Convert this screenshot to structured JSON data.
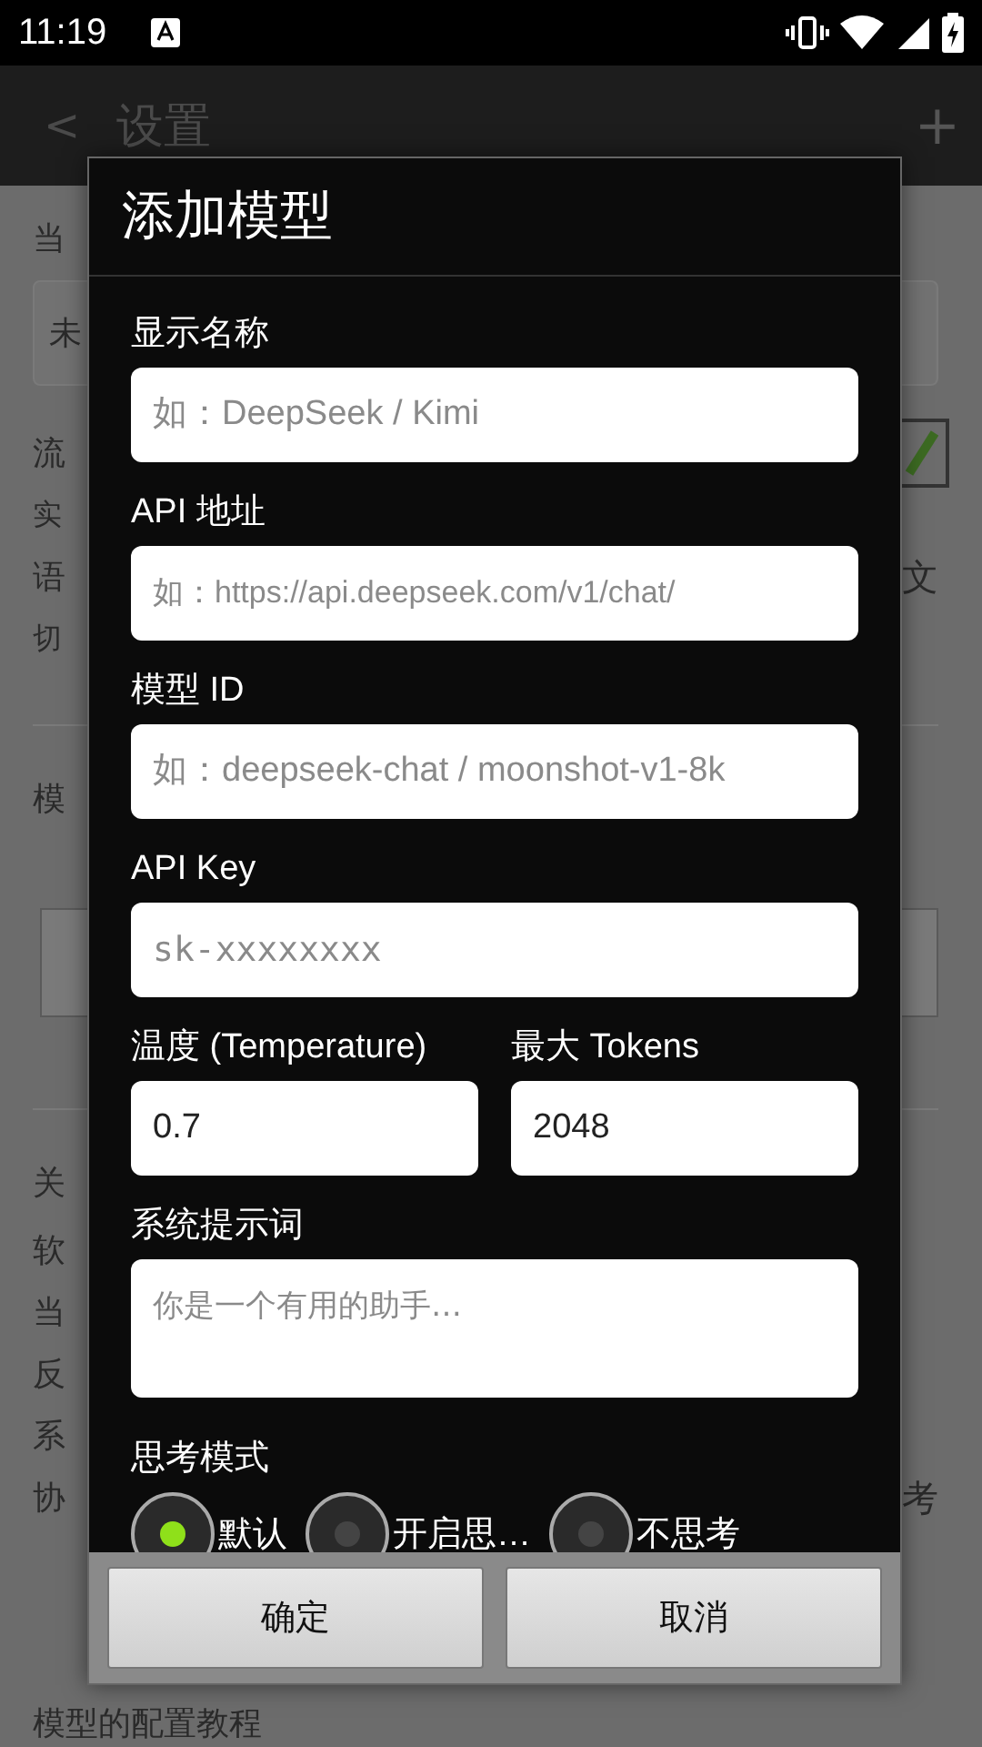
{
  "status_bar": {
    "time": "11:19"
  },
  "background": {
    "back": "<",
    "title": "设置",
    "add": "+",
    "rows": [
      {
        "kind": "label",
        "text": "当"
      },
      {
        "kind": "select",
        "text": "未"
      },
      {
        "kind": "label",
        "text": "流",
        "right": {
          "kind": "checkbox",
          "checked": true
        }
      },
      {
        "kind": "sub",
        "text": "实"
      },
      {
        "kind": "label",
        "text": "语",
        "right": {
          "kind": "text",
          "text": "文"
        }
      },
      {
        "kind": "sub",
        "text": "切"
      },
      {
        "kind": "section",
        "text": "模"
      },
      {
        "kind": "button"
      },
      {
        "kind": "section",
        "text": "关"
      },
      {
        "kind": "label",
        "text": "软"
      },
      {
        "kind": "label",
        "text": "当"
      },
      {
        "kind": "label",
        "text": "反"
      },
      {
        "kind": "label",
        "text": "系"
      },
      {
        "kind": "label",
        "text": "协",
        "right": {
          "kind": "text",
          "text": "考"
        }
      },
      {
        "kind": "label",
        "text": "模型的配置教程"
      }
    ]
  },
  "dialog": {
    "title": "添加模型",
    "fields": [
      {
        "label": "显示名称",
        "placeholder": "如：DeepSeek / Kimi"
      },
      {
        "label": "API 地址",
        "placeholder": "如：https://api.deepseek.com/v1/chat/"
      },
      {
        "label": "模型 ID",
        "placeholder": "如：deepseek-chat / moonshot-v1-8k"
      },
      {
        "label": "API Key",
        "placeholder": "sk-xxxxxxxx"
      }
    ],
    "pair": [
      {
        "label": "温度 (Temperature)",
        "value": "0.7"
      },
      {
        "label": "最大 Tokens",
        "value": "2048"
      }
    ],
    "prompt": {
      "label": "系统提示词",
      "placeholder": "你是一个有用的助手…"
    },
    "thinking": {
      "label": "思考模式",
      "options": [
        {
          "label": "默认",
          "selected": true
        },
        {
          "label": "开启思…",
          "selected": false
        },
        {
          "label": "不思考",
          "selected": false
        }
      ]
    },
    "buttons": [
      "确定",
      "取消"
    ]
  }
}
